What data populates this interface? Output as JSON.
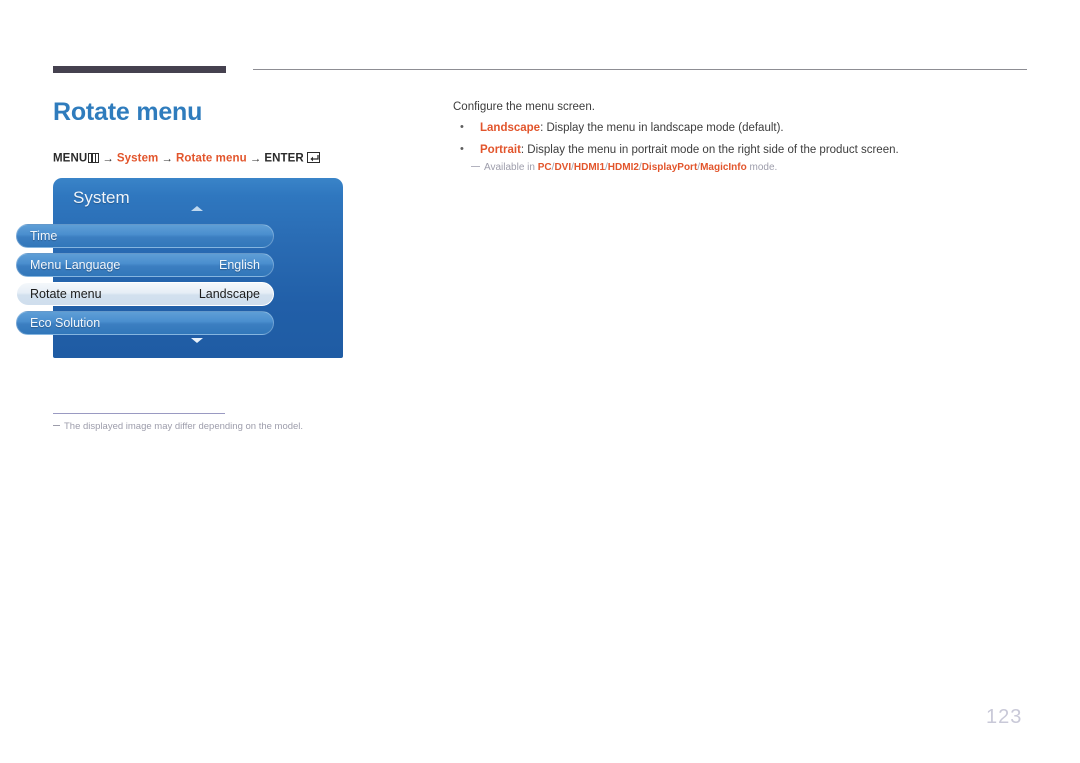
{
  "header": {
    "rule_thick": "",
    "rule_thin": ""
  },
  "page": {
    "title": "Rotate menu",
    "number": "123"
  },
  "menu_path": {
    "menu_label": "MENU",
    "menu_icon": "menu-grid-icon",
    "arrow": "→",
    "step1": "System",
    "step2": "Rotate menu",
    "enter_label": "ENTER",
    "enter_icon": "enter-key-icon"
  },
  "osd": {
    "title": "System",
    "scroll_up_icon": "chevron-up-icon",
    "scroll_down_icon": "chevron-down-icon",
    "rows": [
      {
        "label": "Time",
        "value": "",
        "selected": false
      },
      {
        "label": "Menu Language",
        "value": "English",
        "selected": false
      },
      {
        "label": "Rotate menu",
        "value": "Landscape",
        "selected": true
      },
      {
        "label": "Eco Solution",
        "value": "",
        "selected": false
      }
    ]
  },
  "image_note": "The displayed image may differ depending on the model.",
  "description": {
    "intro": "Configure the menu screen.",
    "bullets": [
      {
        "term": "Landscape",
        "text": ": Display the menu in landscape mode (default)."
      },
      {
        "term": "Portrait",
        "text": ": Display the menu in portrait mode on the right side of the product screen."
      }
    ],
    "availability": {
      "prefix": "Available in ",
      "modes": [
        "PC",
        "DVI",
        "HDMI1",
        "HDMI2",
        "DisplayPort",
        "MagicInfo"
      ],
      "separator": "/",
      "suffix": " mode."
    }
  },
  "colors": {
    "title_blue": "#2f7cbd",
    "accent_orange": "#e2552c",
    "rule_dark": "#45414f",
    "osd_blue": "#2a6cb4",
    "note_gray": "#9d9dab",
    "page_number_gray": "#c9c9d8"
  }
}
